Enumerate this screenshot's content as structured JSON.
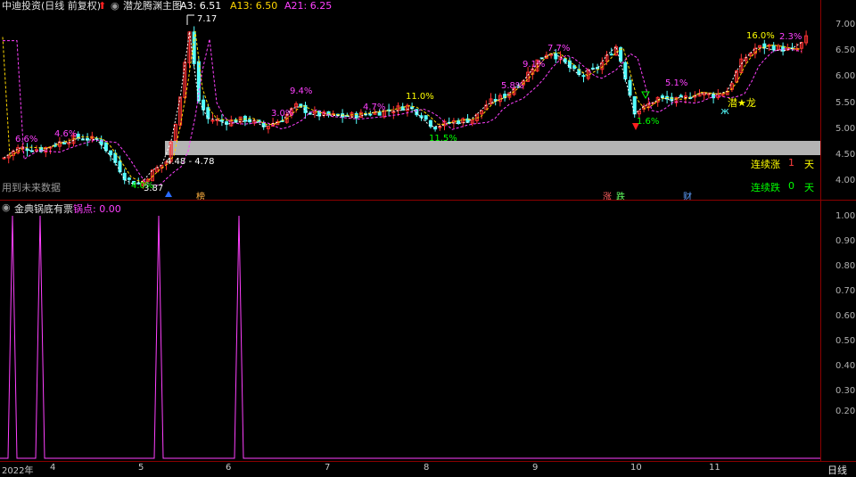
{
  "header": {
    "stock_title": "中迪投资(日线 前复权)",
    "indicator_name": "潜龙腾渊主图",
    "a3_label": "A3: 6.51",
    "a13_label": "A13: 6.50",
    "a21_label": "A21: 6.25",
    "colors": {
      "a3": "#ffffff",
      "a13": "#ffd700",
      "a21": "#ff40ff"
    }
  },
  "main_chart": {
    "y_ticks": [
      "7.00",
      "6.50",
      "6.00",
      "5.50",
      "5.00",
      "4.50",
      "4.00"
    ],
    "high_label": "7.17",
    "box_label": "4.48 - 4.78",
    "low_label": "3.87",
    "future_data_note": "用到未来数据",
    "pct_labels": [
      {
        "text": "6.6%",
        "color": "#ff40ff"
      },
      {
        "text": "4.6%",
        "color": "#ff40ff"
      },
      {
        "text": "4.0%",
        "color": "#00ff00"
      },
      {
        "text": "9.4%",
        "color": "#ff40ff"
      },
      {
        "text": "3.0%",
        "color": "#ff40ff"
      },
      {
        "text": "4.7%",
        "color": "#ff40ff"
      },
      {
        "text": "11.0%",
        "color": "#ffff00"
      },
      {
        "text": "11.5%",
        "color": "#00ff00"
      },
      {
        "text": "5.8%",
        "color": "#ff40ff"
      },
      {
        "text": "9.1%",
        "color": "#ff40ff"
      },
      {
        "text": "7.7%",
        "color": "#ff40ff"
      },
      {
        "text": "5.1%",
        "color": "#ff40ff"
      },
      {
        "text": "1.6%",
        "color": "#00ff00"
      },
      {
        "text": "16.0%",
        "color": "#ffff00"
      },
      {
        "text": "2.3%",
        "color": "#ff40ff"
      }
    ],
    "markers": {
      "bang": "榜",
      "zhang": "涨",
      "die": "跌",
      "cai": "财",
      "dragon": "潜★龙"
    },
    "streak": {
      "up_label": "连续涨",
      "up_count": "1",
      "down_label": "连续跌",
      "down_count": "0",
      "unit": "天"
    },
    "colors": {
      "up": "#ff3232",
      "down": "#54ffff",
      "box": "#b4b4b4"
    }
  },
  "oscillator": {
    "name": "金典锅底有票",
    "value_label": "锅点: 0.00",
    "y_ticks": [
      "1.00",
      "0.90",
      "0.80",
      "0.70",
      "0.60",
      "0.50",
      "0.40",
      "0.30",
      "0.20"
    ],
    "color": "#ff40ff",
    "spike_values": [
      1,
      1,
      1,
      1
    ]
  },
  "x_axis": {
    "labels": [
      "2022年",
      "4",
      "5",
      "6",
      "7",
      "8",
      "9",
      "10",
      "11"
    ],
    "period_label": "日线"
  }
}
